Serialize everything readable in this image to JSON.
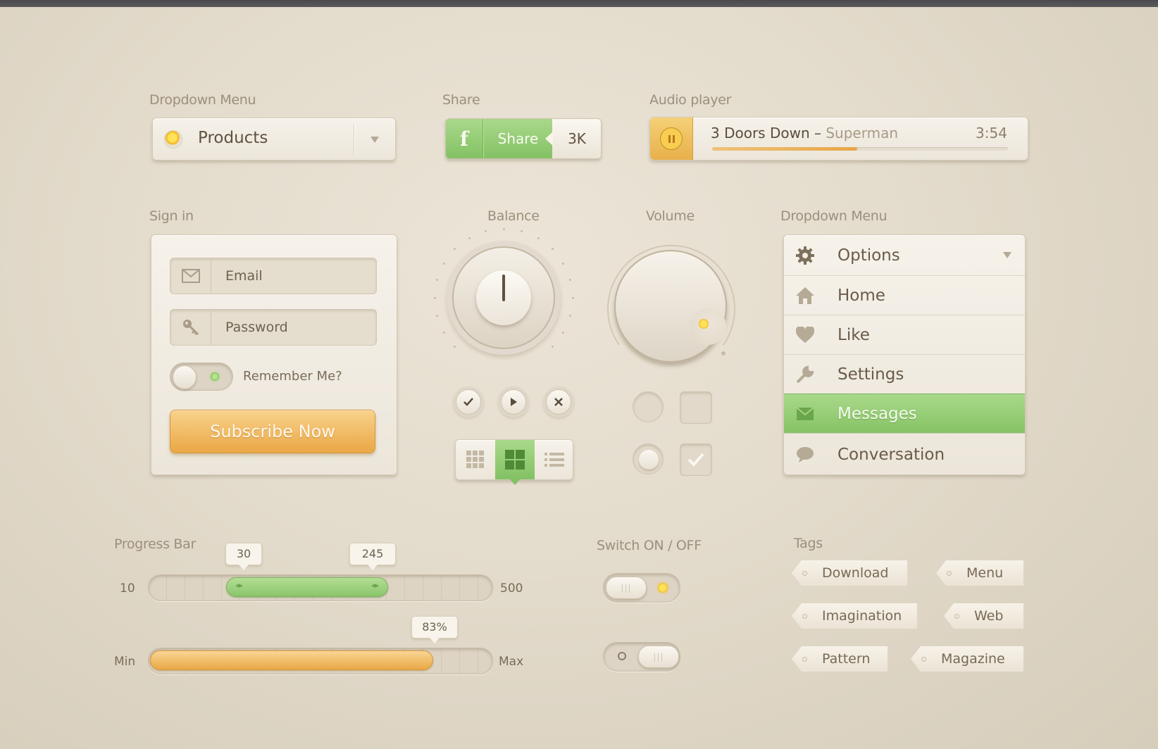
{
  "labels": {
    "dropdown1": "Dropdown Menu",
    "share": "Share",
    "audio": "Audio player",
    "signin": "Sign in",
    "balance": "Balance",
    "volume": "Volume",
    "dropdown2": "Dropdown Menu",
    "progress": "Progress Bar",
    "switch": "Switch ON / OFF",
    "tags": "Tags"
  },
  "dropdown": {
    "selected": "Products"
  },
  "share": {
    "icon": "facebook-icon",
    "label": "Share",
    "count": "3K"
  },
  "audio": {
    "artist": "3 Doors Down",
    "separator": "–",
    "song": "Superman",
    "duration": "3:54",
    "progress": 0.49
  },
  "signin": {
    "email_placeholder": "Email",
    "password_placeholder": "Password",
    "remember_label": "Remember Me?",
    "subscribe_label": "Subscribe Now"
  },
  "balance": {
    "buttons": [
      "check-icon",
      "play-icon",
      "close-icon"
    ]
  },
  "menu": {
    "header": "Options",
    "items": [
      {
        "label": "Home",
        "icon": "home-icon"
      },
      {
        "label": "Like",
        "icon": "heart-icon"
      },
      {
        "label": "Settings",
        "icon": "wrench-icon"
      },
      {
        "label": "Messages",
        "icon": "envelope-icon",
        "active": true
      },
      {
        "label": "Conversation",
        "icon": "speech-bubble-icon"
      }
    ]
  },
  "range": {
    "min": "10",
    "max": "500",
    "low": "30",
    "high": "245"
  },
  "progress": {
    "min": "Min",
    "max": "Max",
    "value": "83%",
    "fraction": 0.83
  },
  "tags": [
    "Download",
    "Menu",
    "Imagination",
    "Web",
    "Pattern",
    "Magazine"
  ],
  "colors": {
    "green": "#8cc76c",
    "orange": "#eeb552",
    "accent_text": "#6a5b49"
  }
}
